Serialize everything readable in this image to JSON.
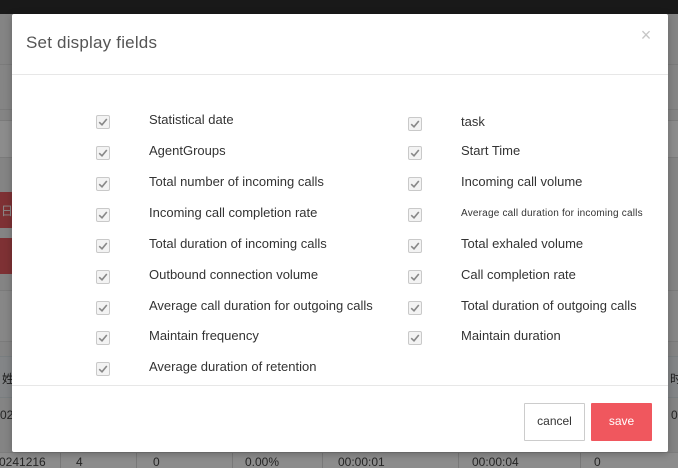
{
  "dialog": {
    "title": "Set display fields",
    "close_symbol": "×",
    "fields_left": [
      {
        "label": "Statistical date",
        "checked": true
      },
      {
        "label": "AgentGroups",
        "checked": true
      },
      {
        "label": "Total number of incoming calls",
        "checked": true
      },
      {
        "label": "Incoming call completion rate",
        "checked": true
      },
      {
        "label": "Total duration of incoming calls",
        "checked": true
      },
      {
        "label": "Outbound connection volume",
        "checked": true
      },
      {
        "label": "Average call duration for outgoing calls",
        "checked": true
      },
      {
        "label": "Maintain frequency",
        "checked": true
      },
      {
        "label": "Average duration of retention",
        "checked": true
      }
    ],
    "fields_right": [
      {
        "label": "task",
        "checked": true
      },
      {
        "label": "Start Time",
        "checked": true
      },
      {
        "label": "Incoming call volume",
        "checked": true
      },
      {
        "label": "Average call duration for incoming calls",
        "checked": true
      },
      {
        "label": "Total exhaled volume",
        "checked": true
      },
      {
        "label": "Call completion rate",
        "checked": true
      },
      {
        "label": "Total duration of outgoing calls",
        "checked": true
      },
      {
        "label": "Maintain duration",
        "checked": true
      }
    ],
    "cancel_label": "cancel",
    "save_label": "save"
  },
  "background": {
    "red_button_glyph": "日",
    "table_header_left_fragment": "姓",
    "table_header_right_fragment": "时",
    "row_fragment_left": "02",
    "row_fragment_right": "0",
    "table_row": [
      "0241216",
      "4",
      "0",
      "0.00%",
      "00:00:01",
      "00:00:04",
      "0"
    ]
  },
  "colors": {
    "accent": "#f0575e",
    "overlay": "rgba(0,0,0,0.45)",
    "checkbox_check": "#888888"
  }
}
